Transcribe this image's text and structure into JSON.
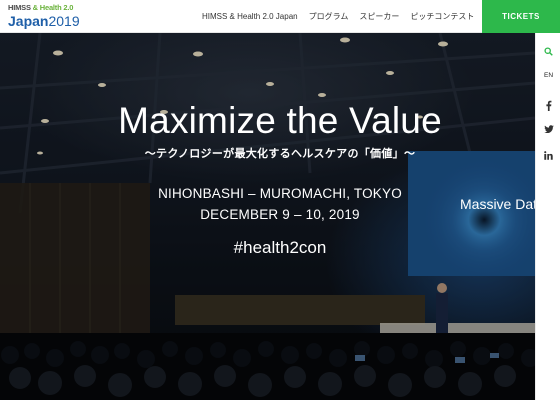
{
  "header": {
    "logo": {
      "top_prefix": "HIMSS",
      "top_amp": "&",
      "top_suffix": "Health 2.0",
      "main": "Japan",
      "year": "2019"
    },
    "nav": [
      {
        "label": "HIMSS & Health 2.0 Japan"
      },
      {
        "label": "プログラム"
      },
      {
        "label": "スピーカー"
      },
      {
        "label": "ピッチコンテスト"
      }
    ],
    "tickets_label": "TICKETS"
  },
  "hero": {
    "title": "Maximize the Value",
    "subtitle": "〜テクノロジーが最大化するヘルスケアの「価値」〜",
    "venue": "NIHONBASHI – MUROMACHI, TOKYO",
    "date": "DECEMBER 9 – 10, 2019",
    "hashtag": "#health2con",
    "screen_text": "Massive Data"
  },
  "sidebar": {
    "language": "EN",
    "icons": [
      "search-icon",
      "facebook-icon",
      "twitter-icon",
      "linkedin-icon"
    ]
  },
  "colors": {
    "accent_green": "#2db84b",
    "logo_blue": "#1f5fa8",
    "logo_green": "#6bb33d"
  }
}
